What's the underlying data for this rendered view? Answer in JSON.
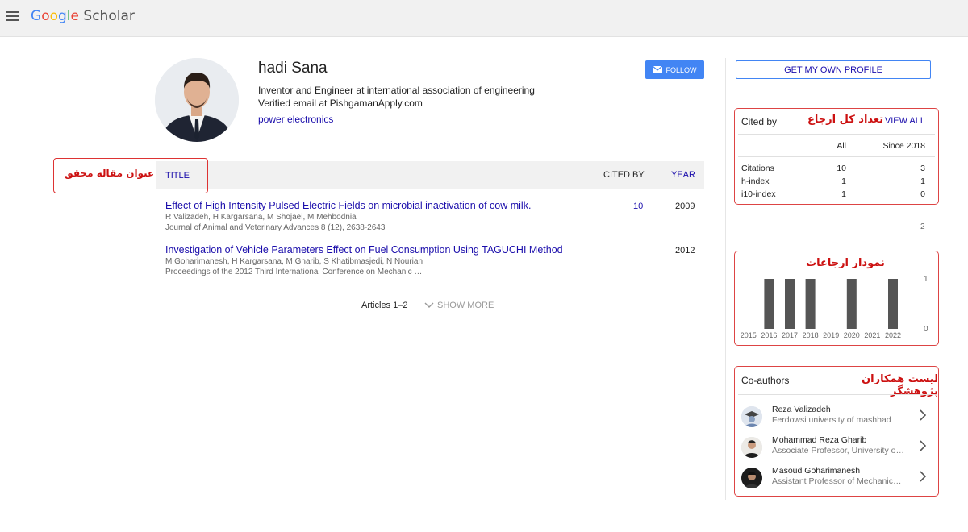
{
  "header": {
    "menu_icon": "hamburger-menu-icon",
    "logo_letters": [
      "G",
      "o",
      "o",
      "g",
      "l",
      "e"
    ],
    "logo_suffix": " Scholar"
  },
  "profile": {
    "name": "hadi Sana",
    "affiliation": "Inventor and Engineer at international association of engineering",
    "email": "Verified email at PishgamanApply.com",
    "interest": "power electronics",
    "follow_label": "FOLLOW"
  },
  "articles_table": {
    "annotation": "عنوان مقاله محقق",
    "col_title": "TITLE",
    "col_cited_by": "CITED BY",
    "col_year": "YEAR",
    "rows": [
      {
        "title": "Effect of High Intensity Pulsed Electric Fields on microbial inactivation of cow milk.",
        "authors": "R Valizadeh, H Kargarsana, M Shojaei, M Mehbodnia",
        "venue": "Journal of Animal and Veterinary Advances 8 (12), 2638-2643",
        "cited_by": "10",
        "year": "2009"
      },
      {
        "title": "Investigation of Vehicle Parameters Effect on Fuel Consumption Using TAGUCHI Method",
        "authors": "M Goharimanesh, H Kargarsana, M Gharib, S Khatibmasjedi, N Nourian",
        "venue": "Proceedings of the 2012 Third International Conference on Mechanic …",
        "cited_by": "",
        "year": "2012"
      }
    ],
    "articles_count": "Articles 1–2",
    "show_more": "SHOW MORE"
  },
  "sidebar": {
    "get_profile": "GET MY OWN PROFILE",
    "cited_by": {
      "title": "Cited by",
      "annotation": "تعداد کل ارجاع",
      "view_all": "VIEW ALL",
      "col_all": "All",
      "col_since": "Since 2018",
      "rows": [
        {
          "label": "Citations",
          "all": "10",
          "since": "3"
        },
        {
          "label": "h-index",
          "all": "1",
          "since": "1"
        },
        {
          "label": "i10-index",
          "all": "1",
          "since": "0"
        }
      ]
    },
    "chart_top_tick": "2",
    "chart_annotation": "نمودار ارجاعات",
    "accent": "#d44444"
  },
  "chart_data": {
    "type": "bar",
    "categories": [
      "2015",
      "2016",
      "2017",
      "2018",
      "2019",
      "2020",
      "2021",
      "2022"
    ],
    "values": [
      0,
      1,
      1,
      1,
      0,
      1,
      0,
      1
    ],
    "ylim": [
      0,
      1
    ],
    "yticks": [
      "0",
      "1"
    ],
    "bar_color": "#555555"
  },
  "coauthors": {
    "title": "Co-authors",
    "annotation": "لیست همکاران پژوهشگر",
    "items": [
      {
        "name": "Reza Valizadeh",
        "affiliation": "Ferdowsi university of mashhad",
        "avatar": "graduate-avatar-icon"
      },
      {
        "name": "Mohammad Reza Gharib",
        "affiliation": "Associate Professor, University o…",
        "avatar": "person-avatar"
      },
      {
        "name": "Masoud Goharimanesh",
        "affiliation": "Assistant Professor of Mechanic…",
        "avatar": "person-avatar"
      }
    ]
  }
}
